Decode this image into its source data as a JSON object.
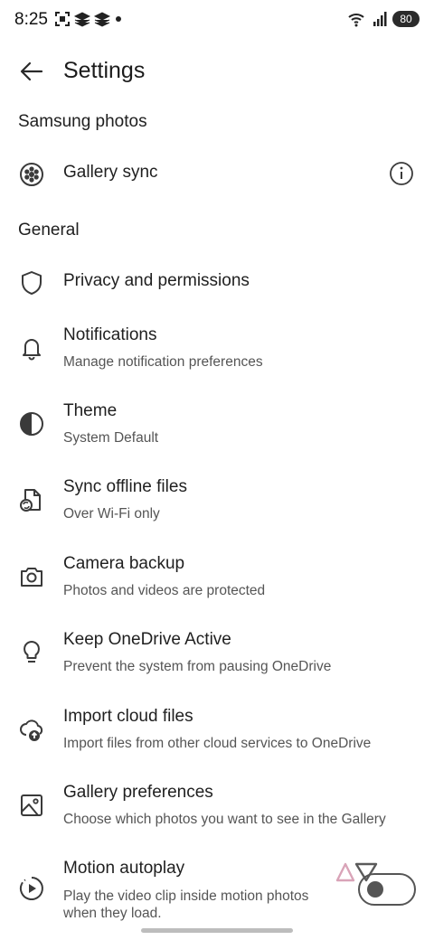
{
  "status_bar": {
    "time": "8:25",
    "battery": "80"
  },
  "header": {
    "title": "Settings"
  },
  "sections": {
    "samsung": "Samsung photos",
    "general": "General"
  },
  "rows": {
    "gallery_sync": {
      "title": "Gallery sync",
      "icon": "aperture-icon"
    },
    "privacy": {
      "title": "Privacy and permissions",
      "icon": "shield-icon"
    },
    "notifications": {
      "title": "Notifications",
      "subtitle": "Manage notification preferences",
      "icon": "bell-icon"
    },
    "theme": {
      "title": "Theme",
      "subtitle": "System Default",
      "icon": "half-circle-icon"
    },
    "sync_offline": {
      "title": "Sync offline files",
      "subtitle": "Over Wi-Fi only",
      "icon": "file-sync-icon"
    },
    "camera_backup": {
      "title": "Camera backup",
      "subtitle": "Photos and videos are protected",
      "icon": "camera-icon"
    },
    "keep_active": {
      "title": "Keep OneDrive Active",
      "subtitle": "Prevent the system from pausing OneDrive",
      "icon": "lightbulb-icon"
    },
    "import_cloud": {
      "title": "Import cloud files",
      "subtitle": "Import files from other cloud services to OneDrive",
      "icon": "cloud-upload-icon"
    },
    "gallery_prefs": {
      "title": "Gallery preferences",
      "subtitle": "Choose which photos you want to see in the Gallery",
      "icon": "image-icon"
    },
    "motion_autoplay": {
      "title": "Motion autoplay",
      "subtitle": "Play the video clip inside motion photos when they load.",
      "icon": "play-circle-icon",
      "enabled": false
    }
  },
  "colors": {
    "text": "#1f1f1f",
    "subtext": "#555555",
    "icon": "#3a3a3a",
    "watermark": "#d9a4b8"
  }
}
